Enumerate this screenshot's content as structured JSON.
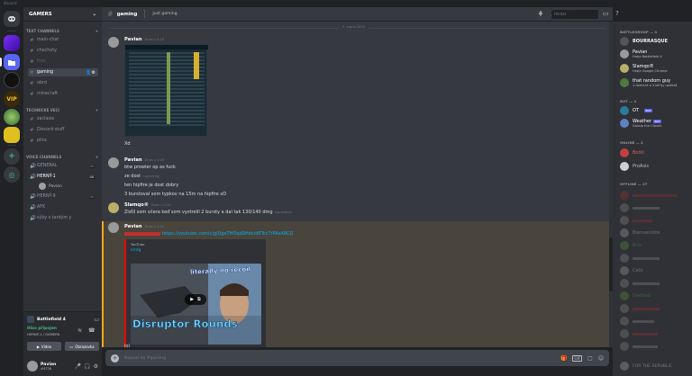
{
  "app_title": "discord",
  "guild_icons": [
    "direct-messages",
    "server-purple",
    "server-blue",
    "server-yellow",
    "server-vip",
    "server-green",
    "add-server",
    "explore"
  ],
  "server": {
    "name": "GAMERS"
  },
  "categories": {
    "text": "TEXT CHANNELS",
    "tech": "TECHNICKE VECI",
    "voice": "VOICE CHANNELS"
  },
  "text_channels": [
    "main-chat",
    "chechoty",
    "fnm",
    "gaming",
    "obrd",
    "minecraft"
  ],
  "tech_channels": [
    "zaclasie",
    "Discord-stuff",
    "plinc"
  ],
  "voice_channels": [
    "GENERAL",
    "HERNÝ-1",
    "HERNÝ-9",
    "AFK",
    "sýby s tardým y"
  ],
  "voice_counts": [
    "00",
    "00",
    "00"
  ],
  "voice_users": [
    "Pavian"
  ],
  "voice_panel": {
    "game": "Battlefield 4",
    "status": "Hlas připojen",
    "sub": "HERNÝ-1 / GAMERS",
    "tab_video": "Video",
    "tab_screen": "Obrazovka"
  },
  "user_panel": {
    "name": "Pavian",
    "tag": "#4726"
  },
  "header": {
    "channel": "gaming",
    "topic": "Just gaming"
  },
  "search": {
    "placeholder": "Hledat"
  },
  "date_divider": "2. srpna 2019",
  "messages": [
    {
      "author": "Pavian",
      "time": "Dnes v 0:19",
      "lines": [
        "Xd"
      ]
    },
    {
      "author": "Pavian",
      "time": "Dnes v 0:19",
      "lines": [
        "btw prowler op as fuck",
        "ze dost",
        "ten hipfire je dost dobry",
        "3 burstoval som typkov na 15m na hipfire xD"
      ],
      "edited": "(upraveno)"
    },
    {
      "author": "Slamqo®",
      "time": "Dnes v 0:20",
      "lines": [
        "Zisťil som včera keď som vystrelil 2 bursty a dal tak 130/140 dmg"
      ],
      "edited": "(upraveno)"
    },
    {
      "author": "Pavian",
      "time": "Dnes v 0:22",
      "lines": [
        "https://youtube.com/c/g/UgeTHOqdSHdc/dETcc7rPAsABCQ"
      ]
    },
    {
      "lines": [
        "lol"
      ]
    }
  ],
  "embed": {
    "provider": "YouTube",
    "title": "smfg",
    "overlay_top": "literally no recoil",
    "overlay_bottom": "Disruptor Rounds"
  },
  "composer": {
    "placeholder": "Napsat do #gaming"
  },
  "members": {
    "cat1": "BATTLEGROUP — 4",
    "cat2": "BOT — 2",
    "cat3": "ONLINE — 2",
    "cat4": "OFFLINE — 27",
    "battlegroup": [
      {
        "name": "BOURRASQUE",
        "status": ""
      },
      {
        "name": "Pavian",
        "status": "Hraje Battlefield 4"
      },
      {
        "name": "Slamqo®",
        "status": "Hraje Google Chrome"
      },
      {
        "name": "that random guy",
        "status": "1 dement a 3 leť by rozhlaš"
      }
    ],
    "bots": [
      {
        "name": "OT",
        "badge": "BOT"
      },
      {
        "name": "Weather",
        "badge": "BOT",
        "status": "Gossip the Clouds"
      }
    ],
    "online": [
      "Botki",
      "ProAsis"
    ],
    "offline": [
      "Bienvenidos",
      "Brix",
      "Cato",
      "Daddad",
      "FOR THE REPUBLIC"
    ]
  },
  "colors": {
    "accent": "#5865f2",
    "online": "#43b581",
    "embed_border": "#ff0000",
    "link": "#00b0f4"
  }
}
